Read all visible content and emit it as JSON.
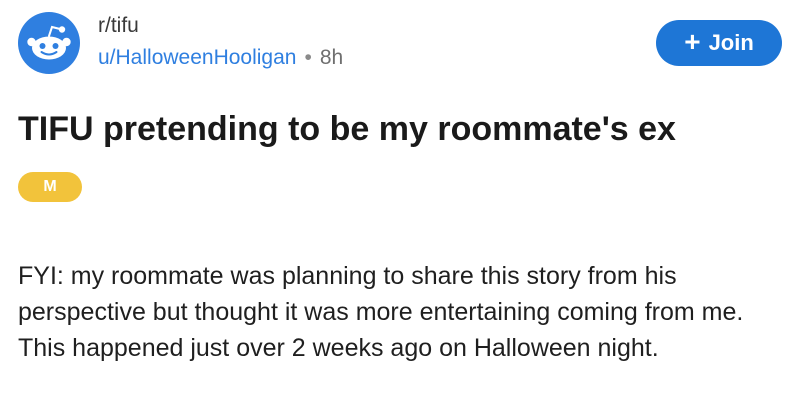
{
  "post": {
    "subreddit": "r/tifu",
    "author": "u/HalloweenHooligan",
    "separator": "•",
    "age": "8h",
    "join_button": {
      "icon": "plus-icon",
      "icon_glyph": "+",
      "label": "Join"
    },
    "title": "TIFU pretending to be my roommate's ex",
    "flair": "M",
    "body": "FYI: my roommate was planning to share this story from his perspective but thought it was more entertaining coming from me. This happened just over 2 weeks ago on Halloween night."
  },
  "icons": {
    "community_avatar": "reddit-alien-icon"
  },
  "colors": {
    "brand_blue": "#1e76d6",
    "avatar_blue": "#2f7fe0",
    "flair_yellow": "#f2c33b",
    "text_dark": "#1a1a1a",
    "meta_gray": "#7c7c7c"
  }
}
